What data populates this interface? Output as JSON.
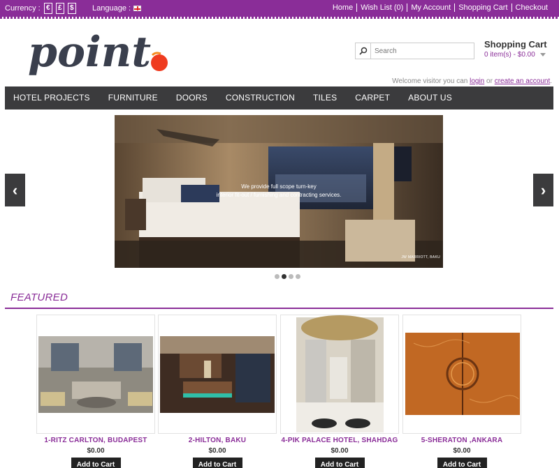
{
  "topbar": {
    "currency_label": "Currency :",
    "currencies": [
      "€",
      "£",
      "$"
    ],
    "language_label": "Language :",
    "links": [
      "Home",
      "Wish List (0)",
      "My Account",
      "Shopping Cart",
      "Checkout"
    ]
  },
  "header": {
    "logo_text": "point",
    "search_placeholder": "Search",
    "cart_title": "Shopping Cart",
    "cart_summary": "0 item(s) - $0.00",
    "welcome_prefix": "Welcome visitor you can",
    "welcome_login": "login",
    "welcome_or": "or",
    "welcome_create": "create an account",
    "welcome_suffix": "."
  },
  "nav": {
    "items": [
      "HOTEL PROJECTS",
      "FURNITURE",
      "DOORS",
      "CONSTRUCTION",
      "TILES",
      "CARPET",
      "ABOUT US"
    ]
  },
  "slider": {
    "caption_line1": "We provide full scope turn-key",
    "caption_line2": "interior fit-out / furnishing and contracting services.",
    "credit": "JW MARRIOTT, BAKU",
    "prev_glyph": "‹",
    "next_glyph": "›",
    "dot_count": 4,
    "active_dot": 1
  },
  "featured": {
    "title": "FEATURED",
    "products": [
      {
        "name": "1-RITZ CARLTON, BUDAPEST",
        "price": "$0.00",
        "button": "Add to Cart"
      },
      {
        "name": "2-HILTON, BAKU",
        "price": "$0.00",
        "button": "Add to Cart"
      },
      {
        "name": "4-PIK PALACE HOTEL, SHAHDAG",
        "price": "$0.00",
        "button": "Add to Cart"
      },
      {
        "name": "5-SHERATON ,ANKARA",
        "price": "$0.00",
        "button": "Add to Cart"
      }
    ]
  },
  "colors": {
    "brand_purple": "#8a2d98",
    "nav_dark": "#3b3b3d",
    "logo_orange": "#ef3b1f"
  }
}
